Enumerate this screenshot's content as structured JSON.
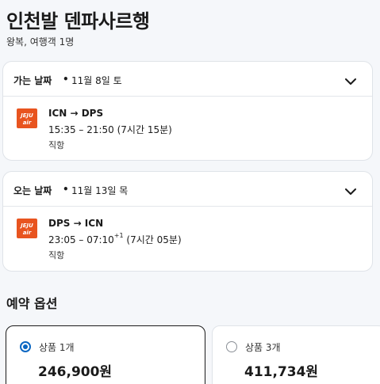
{
  "header": {
    "title": "인천발 덴파사르행",
    "subtitle": "왕복, 여행객 1명"
  },
  "outbound": {
    "label": "가는 날짜",
    "separator": "•",
    "date": "11월 8일 토",
    "airline_logo_text": [
      "JEJU",
      "air"
    ],
    "route": "ICN → DPS",
    "times": "15:35 – 21:50 (7시간 15분)",
    "stops": "직항",
    "icon": "chevron-down-icon"
  },
  "inbound": {
    "label": "오는 날짜",
    "separator": "•",
    "date": "11월 13일 목",
    "airline_logo_text": [
      "JEJU",
      "air"
    ],
    "route": "DPS → ICN",
    "depart_arrive": "23:05 – 07:10",
    "next_day": "+1",
    "duration": "(7시간 05분)",
    "stops": "직항",
    "icon": "chevron-down-icon"
  },
  "booking": {
    "title": "예약 옵션",
    "options": [
      {
        "label": "상품 1개",
        "price": "246,900원",
        "selected": true
      },
      {
        "label": "상품 3개",
        "price": "411,734원",
        "selected": false
      }
    ]
  },
  "colors": {
    "accent": "#0a66c2",
    "brand_logo": "#e8541f",
    "background": "#f5f7fa"
  }
}
